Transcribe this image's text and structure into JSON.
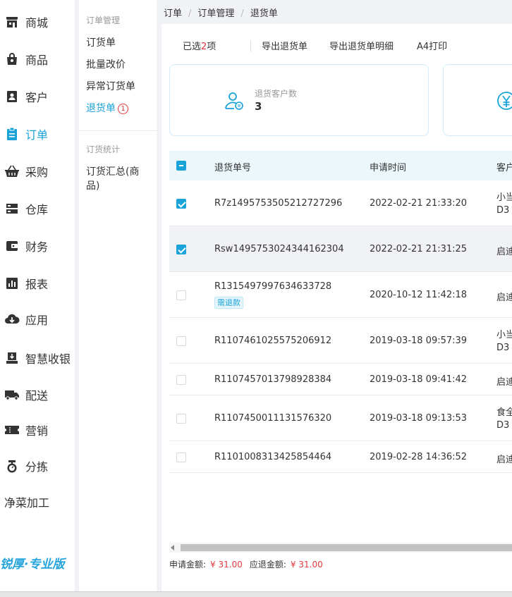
{
  "sidebar": {
    "items": [
      {
        "label": "商城",
        "icon": "store-icon"
      },
      {
        "label": "商品",
        "icon": "bag-icon"
      },
      {
        "label": "客户",
        "icon": "customer-icon"
      },
      {
        "label": "订单",
        "icon": "clipboard-icon",
        "active": true
      },
      {
        "label": "采购",
        "icon": "basket-icon"
      },
      {
        "label": "仓库",
        "icon": "warehouse-icon"
      },
      {
        "label": "财务",
        "icon": "wallet-icon"
      },
      {
        "label": "报表",
        "icon": "bar-chart-icon"
      },
      {
        "label": "应用",
        "icon": "cloud-download-icon"
      },
      {
        "label": "智慧收银",
        "icon": "cashier-icon"
      },
      {
        "label": "配送",
        "icon": "truck-icon"
      },
      {
        "label": "营销",
        "icon": "ticket-icon"
      },
      {
        "label": "分拣",
        "icon": "scale-icon"
      },
      {
        "label": "净菜加工",
        "icon": ""
      }
    ],
    "brand": "锐厚·专业版"
  },
  "submenu": {
    "group1": "订单管理",
    "items1": [
      "订货单",
      "批量改价",
      "异常订货单"
    ],
    "active_item": "退货单",
    "active_badge": "1",
    "group2": "订货统计",
    "items2": [
      "订货汇总(商品)"
    ]
  },
  "breadcrumb": [
    "订单",
    "订单管理",
    "退货单"
  ],
  "toolbar": {
    "selected_prefix": "已选",
    "selected_count": "2",
    "selected_suffix": "项",
    "export_returns": "导出退货单",
    "export_details": "导出退货单明细",
    "print_a4": "A4打印"
  },
  "stats": {
    "card1_label": "退货客户数",
    "card1_value": "3",
    "card2_icon": "yen-icon"
  },
  "table": {
    "columns": [
      "退货单号",
      "申请时间",
      "客户"
    ],
    "rows": [
      {
        "id": "R7z1495753505212727296",
        "time": "2022-02-21 21:33:20",
        "cust1": "小当",
        "cust2": "D3",
        "checked": true,
        "tag": ""
      },
      {
        "id": "Rsw1495753024344162304",
        "time": "2022-02-21 21:31:25",
        "cust1": "启迪",
        "cust2": "",
        "checked": true,
        "tag": ""
      },
      {
        "id": "R1315497997634633728",
        "time": "2020-10-12 11:42:18",
        "cust1": "启迪",
        "cust2": "",
        "checked": false,
        "tag": "需退款"
      },
      {
        "id": "R1107461025575206912",
        "time": "2019-03-18 09:57:39",
        "cust1": "小当",
        "cust2": "D3",
        "checked": false,
        "tag": ""
      },
      {
        "id": "R1107457013798928384",
        "time": "2019-03-18 09:41:42",
        "cust1": "启迪",
        "cust2": "",
        "checked": false,
        "tag": ""
      },
      {
        "id": "R1107450011131576320",
        "time": "2019-03-18 09:13:53",
        "cust1": "食全",
        "cust2": "D3",
        "checked": false,
        "tag": ""
      },
      {
        "id": "R1101008313425854464",
        "time": "2019-02-28 14:36:52",
        "cust1": "启迪",
        "cust2": "",
        "checked": false,
        "tag": ""
      }
    ]
  },
  "footer": {
    "apply_label": "申请金额:",
    "apply_amount": "¥ 31.00",
    "refund_label": "应退金额:",
    "refund_amount": "¥ 31.00"
  },
  "colors": {
    "accent": "#1aa3d9",
    "danger": "#e4393c",
    "header_bg": "#ebf7fb"
  }
}
